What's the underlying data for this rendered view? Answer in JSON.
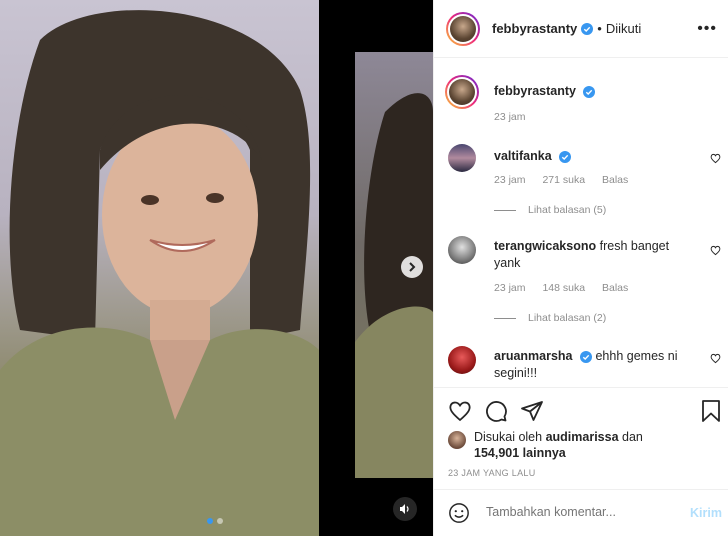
{
  "header": {
    "username": "febbyrastanty",
    "separator": "•",
    "follow_status": "Diikuti",
    "more_label": "•••"
  },
  "caption": {
    "username": "febbyrastanty",
    "text": "",
    "time": "23 jam"
  },
  "comments": [
    {
      "username": "valtifanka",
      "verified": true,
      "text": "",
      "time": "23 jam",
      "likes": "271 suka",
      "reply_label": "Balas",
      "view_replies": "Lihat balasan (5)"
    },
    {
      "username": "terangwicaksono",
      "verified": false,
      "text": "fresh banget yank",
      "time": "23 jam",
      "likes": "148 suka",
      "reply_label": "Balas",
      "view_replies": "Lihat balasan (2)"
    },
    {
      "username": "aruanmarsha",
      "verified": true,
      "text": "ehhh gemes ni segini!!!",
      "time": "",
      "likes": "",
      "reply_label": "",
      "view_replies": ""
    }
  ],
  "likes": {
    "prefix": "Disukai oleh",
    "user": "audimarissa",
    "middle": "dan",
    "count": "154,901",
    "suffix": "lainnya"
  },
  "post_time": "23 JAM YANG LALU",
  "comment_box": {
    "placeholder": "Tambahkan komentar...",
    "post_label": "Kirim"
  },
  "carousel": {
    "slide_count": 2,
    "active_index": 0
  },
  "colors": {
    "verified": "#3897f0",
    "muted": "#8e8e8e",
    "post_disabled": "#b2dffc"
  }
}
